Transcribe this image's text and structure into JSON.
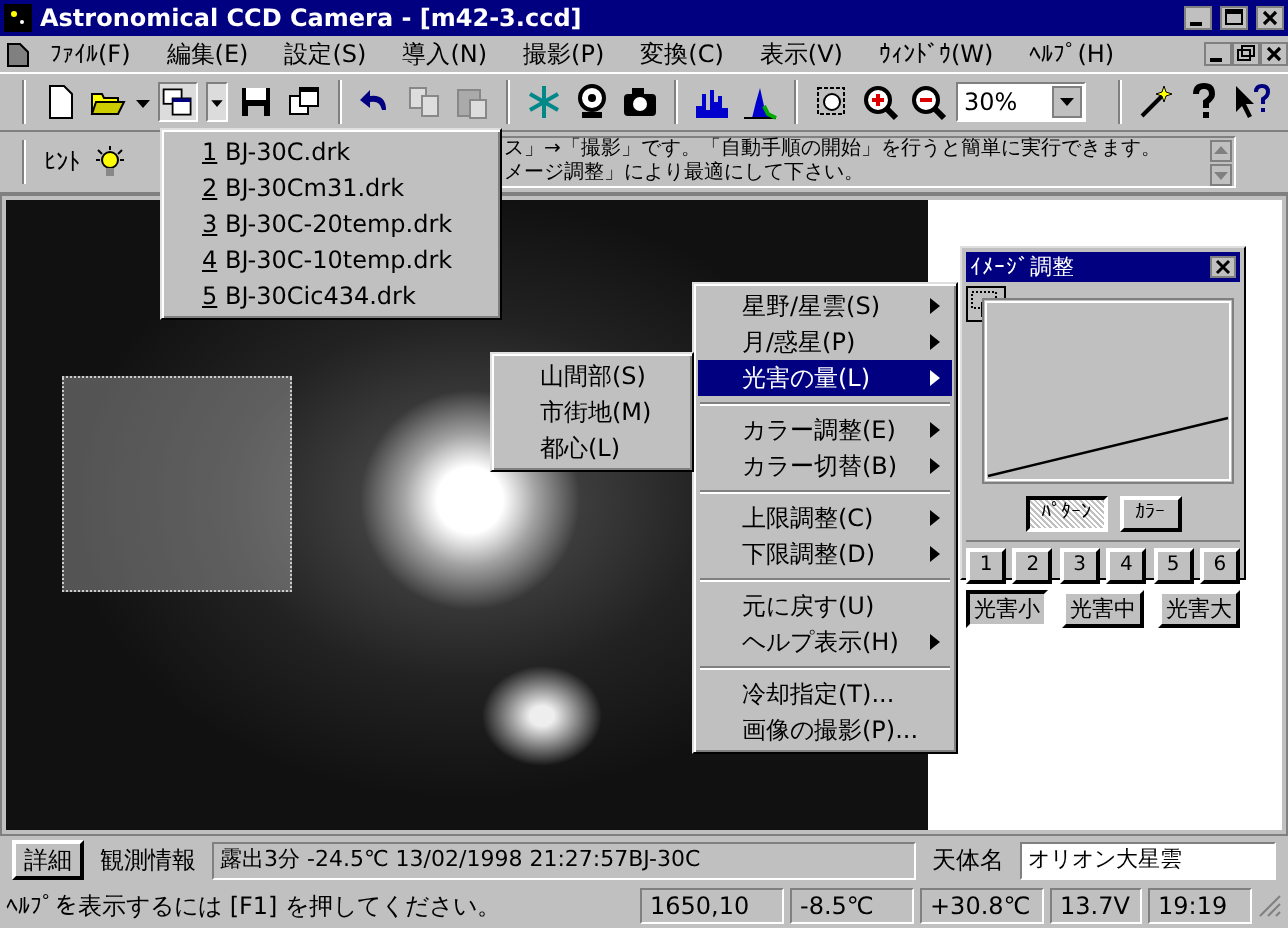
{
  "window": {
    "title": "Astronomical CCD Camera - [m42-3.ccd]"
  },
  "menu_bar": [
    {
      "label": "ﾌｧｲﾙ(F)"
    },
    {
      "label": "編集(E)"
    },
    {
      "label": "設定(S)"
    },
    {
      "label": "導入(N)"
    },
    {
      "label": "撮影(P)"
    },
    {
      "label": "変換(C)"
    },
    {
      "label": "表示(V)"
    },
    {
      "label": "ｳｨﾝﾄﾞｳ(W)"
    },
    {
      "label": "ﾍﾙﾌﾟ(H)"
    }
  ],
  "toolbar": {
    "zoom": "30%",
    "recent_pressed": true
  },
  "hint_bar": {
    "label": "ﾋﾝﾄ",
    "lines": [
      "ス」→「撮影」です。「自動手順の開始」を行うと簡単に実行できます。",
      "メージ調整」により最適にして下さい。"
    ]
  },
  "recent_files_menu": [
    {
      "number": "1",
      "label": "BJ-30C.drk"
    },
    {
      "number": "2",
      "label": "BJ-30Cm31.drk"
    },
    {
      "number": "3",
      "label": "BJ-30C-20temp.drk"
    },
    {
      "number": "4",
      "label": "BJ-30C-10temp.drk"
    },
    {
      "number": "5",
      "label": "BJ-30Cic434.drk"
    }
  ],
  "context_menu": [
    {
      "kind": "item",
      "label": "星野/星雲(S)",
      "submenu": true,
      "selected": false
    },
    {
      "kind": "item",
      "label": "月/惑星(P)",
      "submenu": true,
      "selected": false
    },
    {
      "kind": "item",
      "label": "光害の量(L)",
      "submenu": true,
      "selected": true
    },
    {
      "kind": "separator"
    },
    {
      "kind": "item",
      "label": "カラー調整(E)",
      "submenu": true,
      "selected": false
    },
    {
      "kind": "item",
      "label": "カラー切替(B)",
      "submenu": true,
      "selected": false
    },
    {
      "kind": "separator"
    },
    {
      "kind": "item",
      "label": "上限調整(C)",
      "submenu": true,
      "selected": false
    },
    {
      "kind": "item",
      "label": "下限調整(D)",
      "submenu": true,
      "selected": false
    },
    {
      "kind": "separator"
    },
    {
      "kind": "item",
      "label": "元に戻す(U)",
      "submenu": false,
      "selected": false
    },
    {
      "kind": "item",
      "label": "ヘルプ表示(H)",
      "submenu": true,
      "selected": false
    },
    {
      "kind": "separator"
    },
    {
      "kind": "item",
      "label": "冷却指定(T)...",
      "submenu": false,
      "selected": false
    },
    {
      "kind": "item",
      "label": "画像の撮影(P)...",
      "submenu": false,
      "selected": false
    }
  ],
  "submenu": [
    {
      "label": "山間部(S)"
    },
    {
      "label": "市街地(M)"
    },
    {
      "label": "都心(L)"
    }
  ],
  "image_adjust": {
    "title": "ｲﾒｰｼﾞ調整",
    "tabs": [
      {
        "label": "ﾊﾟﾀｰﾝ",
        "selected": true
      },
      {
        "label": "ｶﾗｰ",
        "selected": false
      }
    ],
    "presets": [
      "1",
      "2",
      "3",
      "4",
      "5",
      "6"
    ],
    "light_buttons": [
      {
        "label": "光害小",
        "selected": true
      },
      {
        "label": "光害中",
        "selected": false
      },
      {
        "label": "光害大",
        "selected": false
      }
    ]
  },
  "info_bar": {
    "button": "詳細",
    "info_label": "観測情報",
    "info": "露出3分 -24.5℃ 13/02/1998 21:27:57BJ-30C",
    "object_label": "天体名",
    "object": "オリオン大星雲"
  },
  "status_bar": {
    "help": "ﾍﾙﾌﾟを表示するには [F1] を押してください。",
    "panels": [
      "1650,10",
      "-8.5℃",
      "+30.8℃",
      "13.7V",
      "19:19"
    ]
  }
}
